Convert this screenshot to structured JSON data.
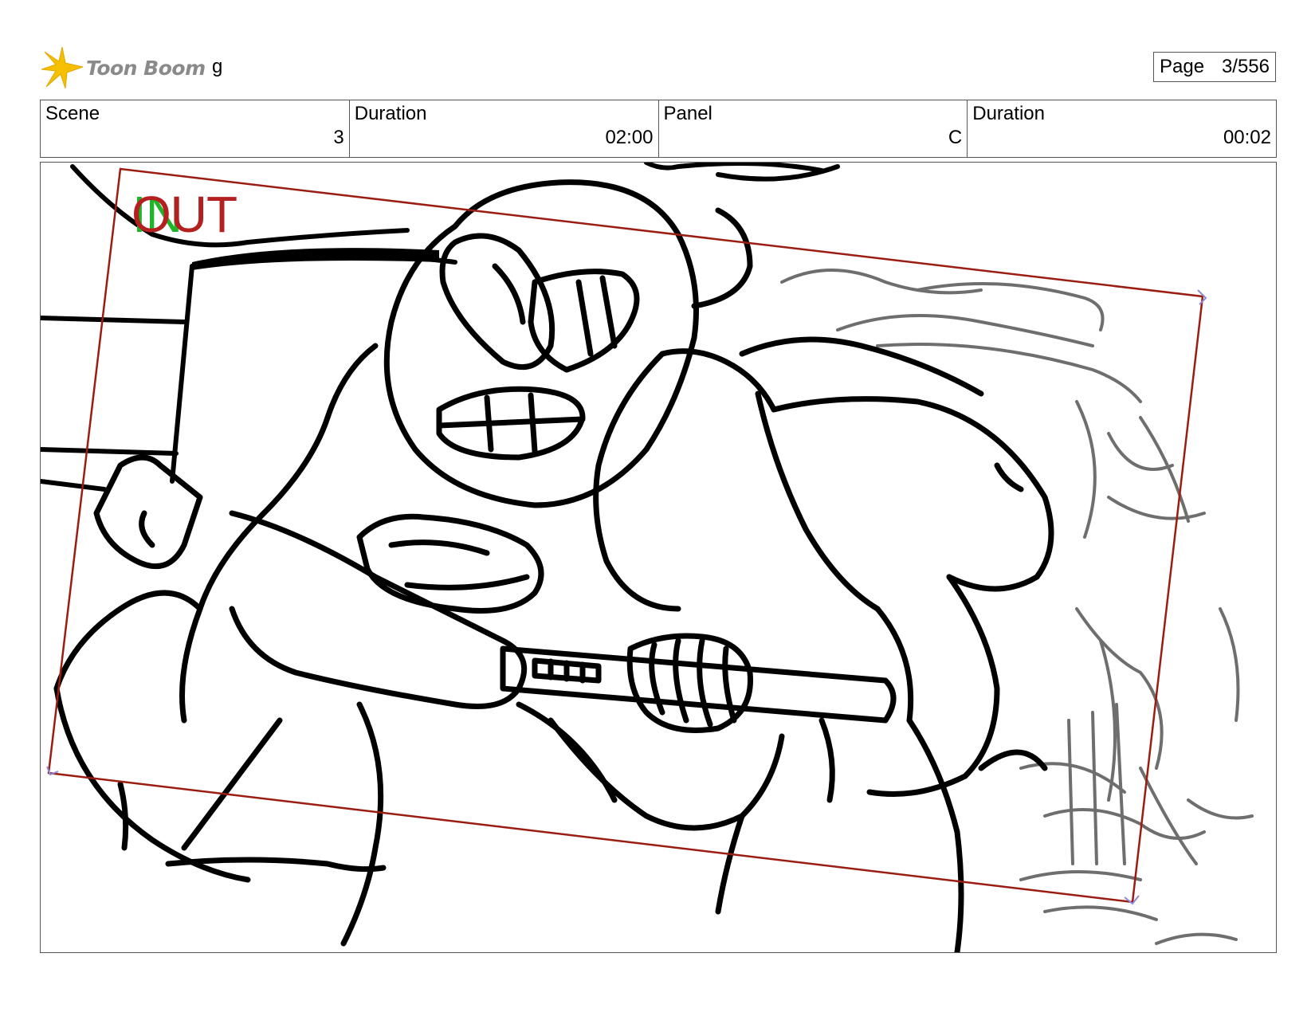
{
  "header": {
    "brand": "Toon Boom",
    "project": "g",
    "page_label": "Page",
    "page_value": "3/556"
  },
  "info": {
    "scene_label": "Scene",
    "scene_value": "3",
    "scene_duration_label": "Duration",
    "scene_duration_value": "02:00",
    "panel_label": "Panel",
    "panel_value": "C",
    "panel_duration_label": "Duration",
    "panel_duration_value": "00:02"
  },
  "panel": {
    "in_label": "IN",
    "out_label": "OUT",
    "camera_color": "#9b1d12",
    "in_color": "#1fb52a",
    "out_color": "#b3201f"
  },
  "colors": {
    "logo_star": "#f5c000",
    "brand_text": "#8a8a8a",
    "border": "#555555"
  }
}
